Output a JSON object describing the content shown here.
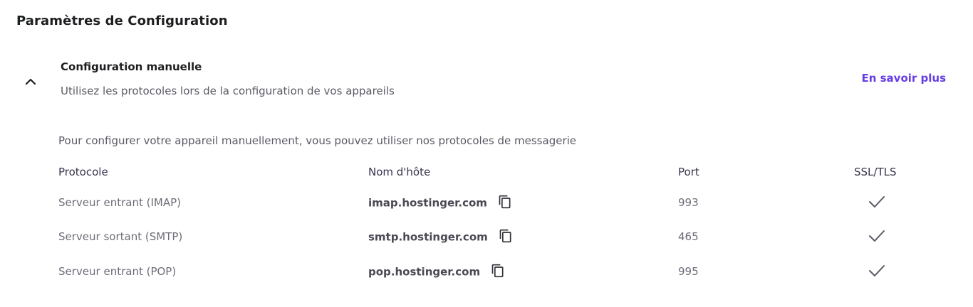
{
  "page": {
    "title": "Paramètres de Configuration"
  },
  "section": {
    "title": "Configuration manuelle",
    "subtitle": "Utilisez les protocoles lors de la configuration de vos appareils",
    "learn_more": "En savoir plus",
    "toggle_icon": "chevron-up-icon",
    "intro": "Pour configurer votre appareil manuellement, vous pouvez utiliser nos protocoles de messagerie"
  },
  "table": {
    "headers": [
      "Protocole",
      "Nom d'hôte",
      "Port",
      "SSL/TLS"
    ],
    "rows": [
      {
        "protocol": "Serveur entrant (IMAP)",
        "host": "imap.hostinger.com",
        "port": "993",
        "ssl": true
      },
      {
        "protocol": "Serveur sortant (SMTP)",
        "host": "smtp.hostinger.com",
        "port": "465",
        "ssl": true
      },
      {
        "protocol": "Serveur entrant (POP)",
        "host": "pop.hostinger.com",
        "port": "995",
        "ssl": true
      }
    ]
  },
  "colors": {
    "accent": "#673de6",
    "heading": "#1d1e20",
    "muted": "#6d6d78"
  }
}
